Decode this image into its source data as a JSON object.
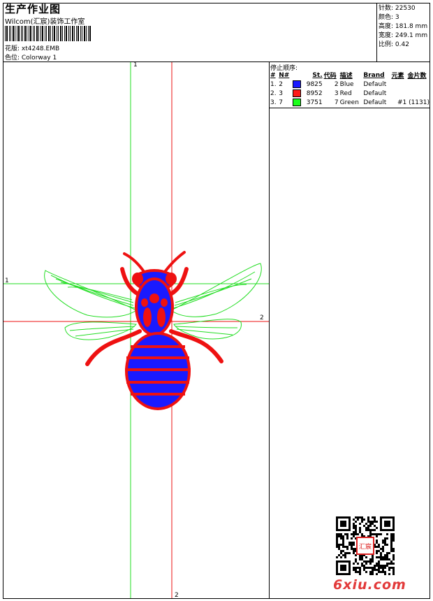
{
  "header": {
    "title": "生产作业图",
    "company": "Wilcom(汇宸)装饰工作室",
    "design_label": "花版: xt4248.EMB",
    "colorway_label": "色位:  Colorway 1"
  },
  "stats": [
    {
      "label": "针数:",
      "value": "22530"
    },
    {
      "label": "颜色:",
      "value": "3"
    },
    {
      "label": "高度:",
      "value": "181.8 mm"
    },
    {
      "label": "宽度:",
      "value": "249.1 mm"
    },
    {
      "label": "比例:",
      "value": "0.42"
    }
  ],
  "stop_sequence": {
    "title": "停止顺序:",
    "columns": [
      "#",
      "N#",
      "St.",
      "代码",
      "描述",
      "Brand",
      "元素",
      "金片数"
    ],
    "rows": [
      {
        "num": "1.",
        "n": "2",
        "color": "#1a1aff",
        "st": "9825",
        "code": "2",
        "desc": "Blue",
        "brand": "Default",
        "elem": "",
        "seq": ""
      },
      {
        "num": "2.",
        "n": "3",
        "color": "#ff1a1a",
        "st": "8952",
        "code": "3",
        "desc": "Red",
        "brand": "Default",
        "elem": "",
        "seq": ""
      },
      {
        "num": "3.",
        "n": "7",
        "color": "#1aff1a",
        "st": "3751",
        "code": "7",
        "desc": "Green",
        "brand": "Default",
        "elem": "#1 (1131)",
        "seq": ""
      }
    ]
  },
  "guides": {
    "v1_label": "1",
    "v2_label": "2",
    "h1_label": "1",
    "h2_label": "2"
  },
  "colors": {
    "blue": "#1a1aff",
    "red": "#ee1111",
    "green": "#22dd22"
  },
  "watermark": "6xiu.com",
  "qr_seal": "汇宸"
}
